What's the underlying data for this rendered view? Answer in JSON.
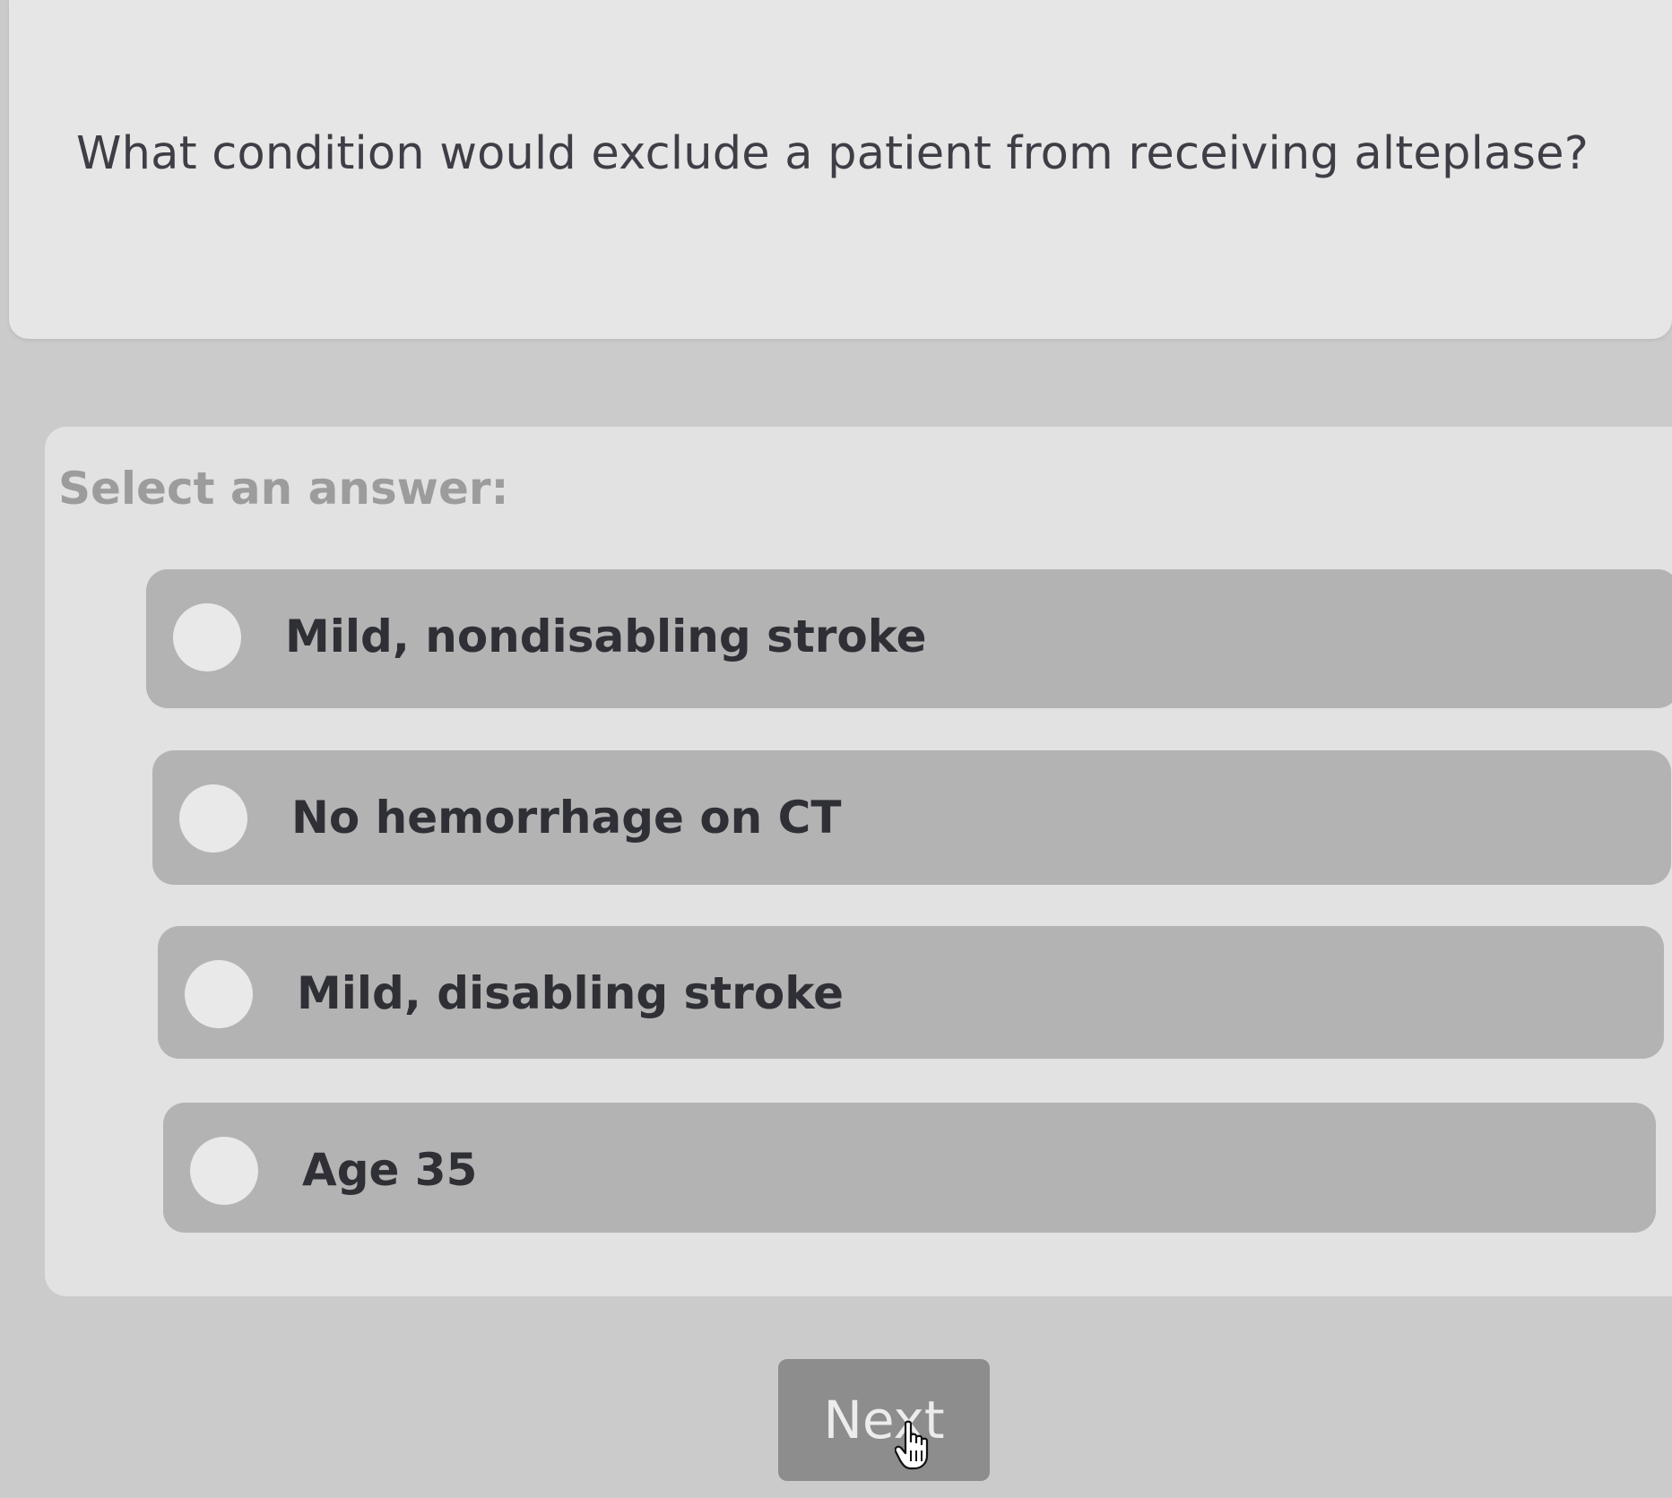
{
  "question": {
    "text": "What condition would exclude a patient from receiving alteplase?"
  },
  "answers": {
    "prompt": "Select an answer:",
    "options": [
      {
        "label": "Mild, nondisabling stroke",
        "selected": false
      },
      {
        "label": "No hemorrhage on CT",
        "selected": false
      },
      {
        "label": "Mild, disabling stroke",
        "selected": false
      },
      {
        "label": "Age 35",
        "selected": false
      }
    ]
  },
  "navigation": {
    "next_label": "Next",
    "cursor_icon": "hand-pointer-icon"
  }
}
